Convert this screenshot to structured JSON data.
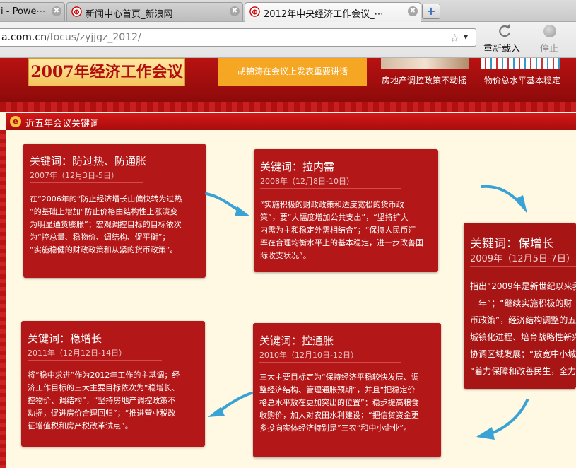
{
  "browser": {
    "tabs": [
      {
        "title": "i - Powe⋯",
        "active": false
      },
      {
        "title": "新闻中心首页_新浪网",
        "active": false
      },
      {
        "title": "2012年中央经济工作会议_⋯",
        "active": true
      }
    ],
    "tab_close_symbol": "✖",
    "new_tab_symbol": "+",
    "url_host": "a.com.cn",
    "url_path": "/focus/zyjjgz_2012/",
    "reload_label": "重新载入",
    "stop_label": "停止"
  },
  "banner": {
    "year_logo": "2007年经济工作会议",
    "headline": "胡锦涛在会议上发表重要讲话",
    "thumb1_caption": "房地产调控政策不动摇",
    "thumb2_caption": "物价总水平基本稳定"
  },
  "section": {
    "icon_glyph": "e",
    "title": "近五年会议关键词"
  },
  "cards": [
    {
      "keyword": "关键词：防过热、防通胀",
      "date": "2007年（12月3日-5日）",
      "lines": [
        "在“2006年的“防止经济增长由偏快转为过热",
        "”的基础上增加“防止价格由结构性上涨演变",
        "为明显通货膨胀”；宏观调控目标的目标依次",
        "为“控总量、稳物价、调结构、促平衡”；",
        "“实施稳健的财政政策和从紧的货币政策”。"
      ]
    },
    {
      "keyword": "关键词：拉内需",
      "date": "2008年（12月8日-10日）",
      "lines": [
        "“实施积极的财政政策和适度宽松的货币政",
        "策”，要“大幅度增加公共支出”，“坚持扩大",
        "内需为主和稳定外需相结合”；“保持人民币汇",
        "率在合理均衡水平上的基本稳定，进一步改善国",
        "际收支状况”。"
      ]
    },
    {
      "keyword": "关键词：稳增长",
      "date": "2011年（12月12日-14日）",
      "lines": [
        "将“稳中求进”作为2012年工作的主基调；经",
        "济工作目标的三大主要目标依次为“稳增长、",
        "控物价、调结构”，“坚持房地产调控政策不",
        "动摇，促进房价合理回归”；“推进营业税改",
        "征增值税和房产税改革试点”。"
      ]
    },
    {
      "keyword": "关键词：控通胀",
      "date": "2010年（12月10日-12日）",
      "lines": [
        "三大主要目标定为“保持经济平稳较快发展、调",
        "整经济结构、管理通胀预期”，并且“把稳定价",
        "格总水平放在更加突出的位置”；稳步提高粮食",
        "收购价，加大对农田水利建设；“把信贷资金更",
        "多投向实体经济特别是”三农“和中小企业”。"
      ]
    },
    {
      "keyword": "关键词：保增长",
      "date": "2009年（12月5日-7日）",
      "lines": [
        "指出“2009年是新世纪以来我",
        "一年”；“继续实施积极的财",
        "币政策”，经济结构调整的五个",
        "城镇化进程、培育战略性新兴",
        "协调区域发展；“放宽中小城",
        "“着力保障和改善民生，全力"
      ]
    }
  ],
  "colors": {
    "card_red": "#b31717",
    "banner_red": "#a80c0c",
    "page_bg": "#fff7e4",
    "headline_orange": "#f5a623",
    "arrow_blue": "#3aa3d6"
  }
}
